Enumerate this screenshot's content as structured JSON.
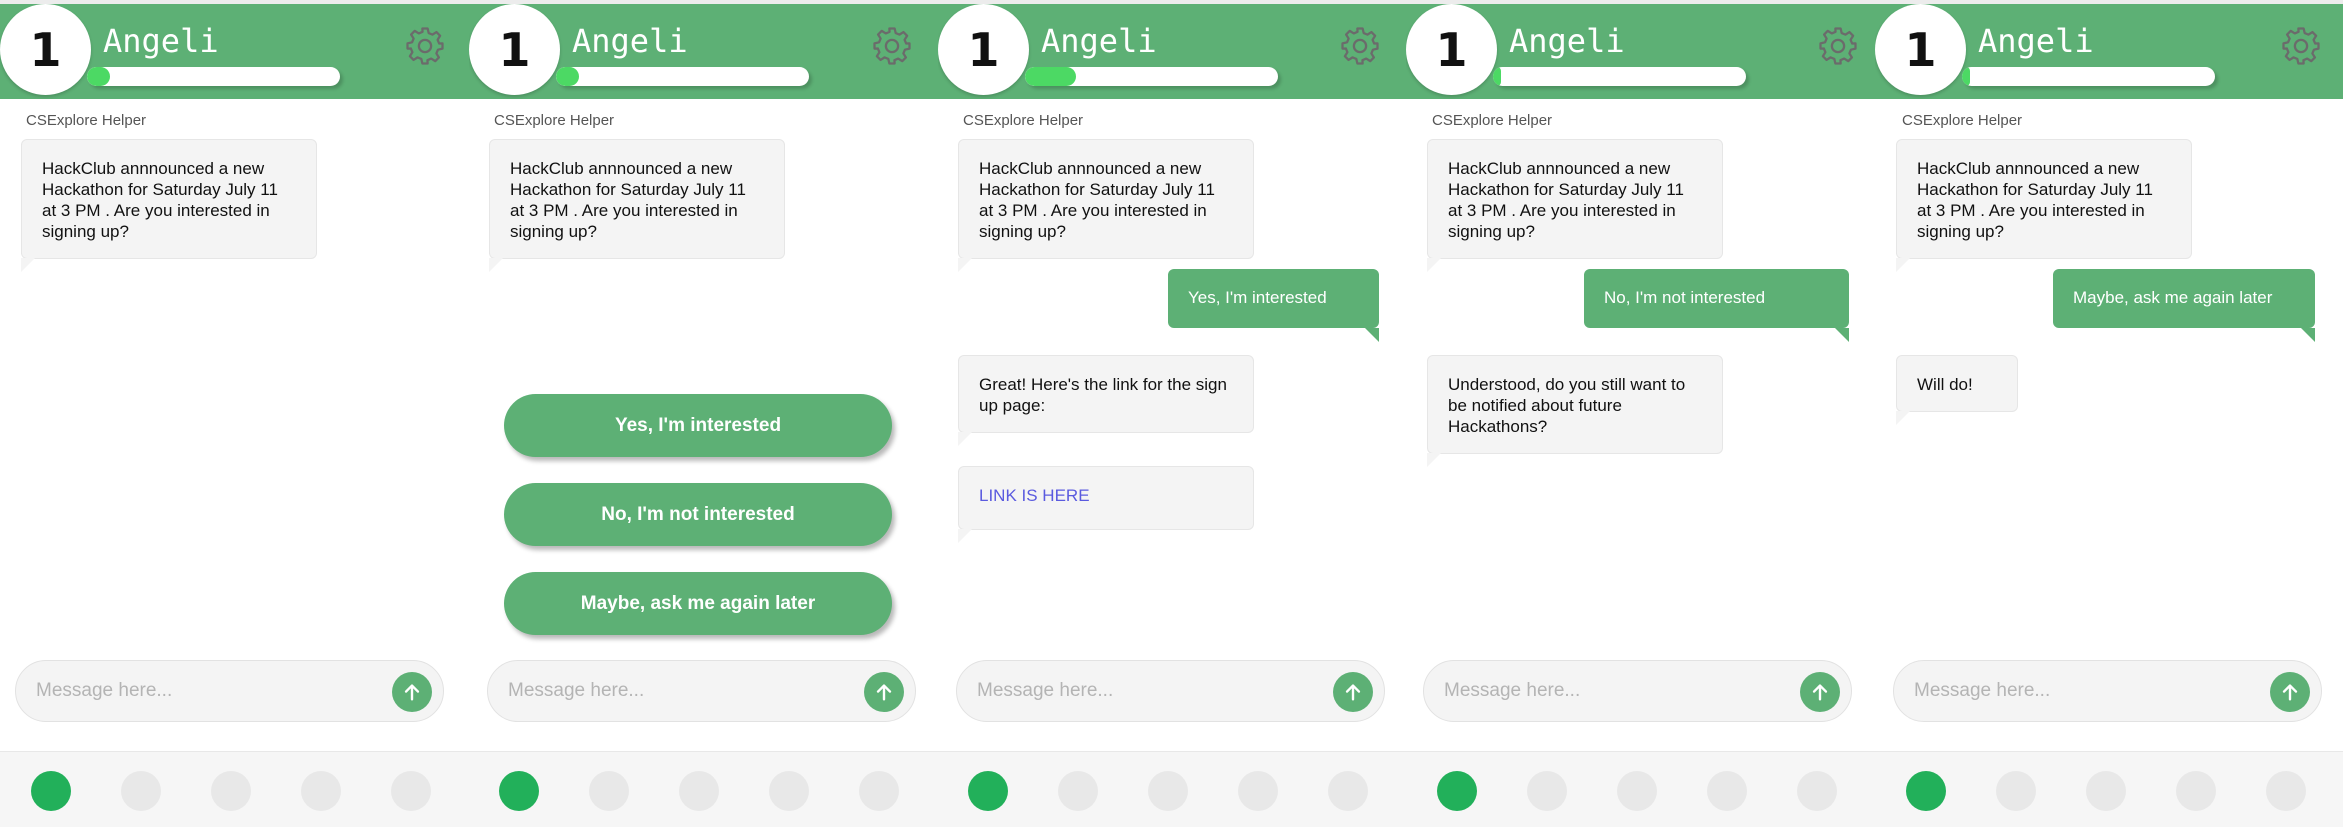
{
  "colors": {
    "accent": "#5db075",
    "xp_fill": "#4cd964",
    "active_dot": "#22b05a",
    "link": "#5a5adf"
  },
  "icons": {
    "settings": "gear-icon",
    "send": "arrow-up-icon"
  },
  "screens": [
    {
      "header": {
        "level": "1",
        "name": "Angeli",
        "xp_progress": 0.09
      },
      "sender": "CSExplore Helper",
      "messages": [
        {
          "from": "bot",
          "text": "HackClub annnounced a new Hackathon for Saturday July 11 at 3 PM . Are you interested in signing up?"
        }
      ],
      "options": [],
      "composer": {
        "placeholder": "Message here..."
      },
      "nav": {
        "active_index": 0,
        "count": 5
      }
    },
    {
      "header": {
        "level": "1",
        "name": "Angeli",
        "xp_progress": 0.09
      },
      "sender": "CSExplore Helper",
      "messages": [
        {
          "from": "bot",
          "text": "HackClub annnounced a new Hackathon for Saturday July 11 at 3 PM . Are you interested in signing up?"
        }
      ],
      "options": [
        "Yes, I'm interested",
        "No, I'm not interested",
        "Maybe, ask me again later"
      ],
      "composer": {
        "placeholder": "Message here..."
      },
      "nav": {
        "active_index": 0,
        "count": 5
      }
    },
    {
      "header": {
        "level": "1",
        "name": "Angeli",
        "xp_progress": 0.2
      },
      "sender": "CSExplore Helper",
      "messages": [
        {
          "from": "bot",
          "text": "HackClub annnounced a new Hackathon for Saturday July 11 at 3 PM . Are you interested in signing up?"
        },
        {
          "from": "user",
          "text": "Yes, I'm interested"
        },
        {
          "from": "bot",
          "text": "Great! Here's the link for the sign up page:"
        },
        {
          "from": "bot",
          "text": "LINK IS HERE",
          "is_link": true
        }
      ],
      "options": [],
      "composer": {
        "placeholder": "Message here..."
      },
      "nav": {
        "active_index": 0,
        "count": 5
      }
    },
    {
      "header": {
        "level": "1",
        "name": "Angeli",
        "xp_progress": 0.03
      },
      "sender": "CSExplore Helper",
      "messages": [
        {
          "from": "bot",
          "text": "HackClub annnounced a new Hackathon for Saturday July 11 at 3 PM . Are you interested in signing up?"
        },
        {
          "from": "user",
          "text": "No, I'm not interested"
        },
        {
          "from": "bot",
          "text": "Understood, do you still want to be notified about future Hackathons?"
        }
      ],
      "options": [],
      "composer": {
        "placeholder": "Message here..."
      },
      "nav": {
        "active_index": 0,
        "count": 5
      }
    },
    {
      "header": {
        "level": "1",
        "name": "Angeli",
        "xp_progress": 0.03
      },
      "sender": "CSExplore Helper",
      "messages": [
        {
          "from": "bot",
          "text": "HackClub annnounced a new Hackathon for Saturday July 11 at 3 PM . Are you interested in signing up?"
        },
        {
          "from": "user",
          "text": "Maybe, ask me again later"
        },
        {
          "from": "bot",
          "text": "Will do!"
        }
      ],
      "options": [],
      "composer": {
        "placeholder": "Message here..."
      },
      "nav": {
        "active_index": 0,
        "count": 5
      }
    }
  ]
}
